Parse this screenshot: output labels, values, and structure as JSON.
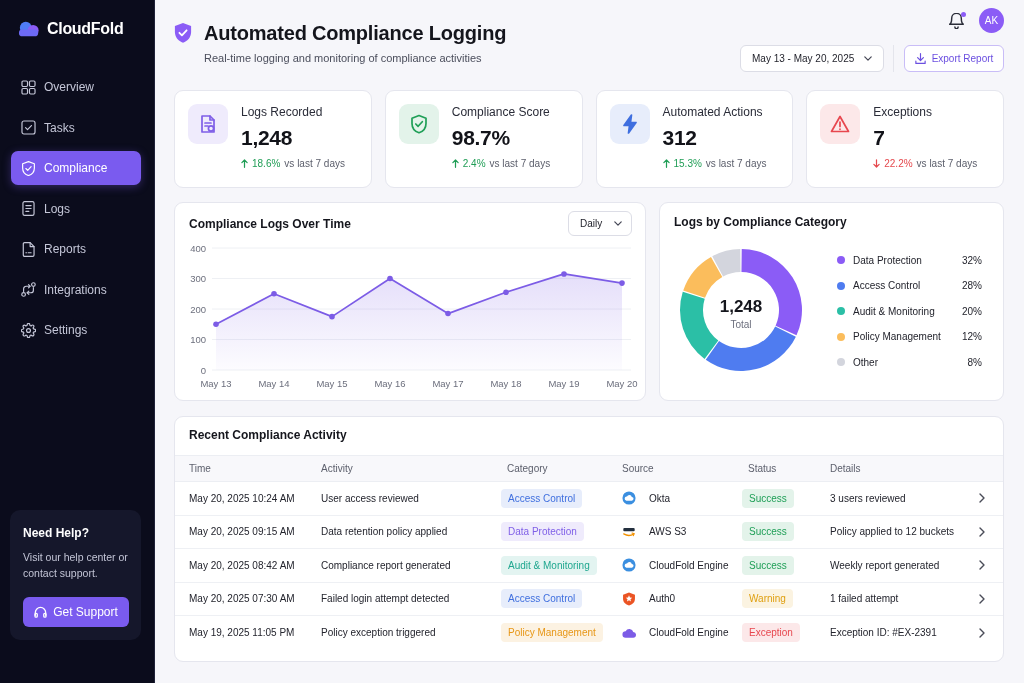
{
  "sidebar": {
    "brand": "CloudFold",
    "nav": [
      {
        "label": "Overview",
        "kind": "grid",
        "selected": false
      },
      {
        "label": "Tasks",
        "kind": "check",
        "selected": false
      },
      {
        "label": "Compliance",
        "kind": "shield",
        "selected": true
      },
      {
        "label": "Logs",
        "kind": "logs",
        "selected": false
      },
      {
        "label": "Reports",
        "kind": "report",
        "selected": false
      },
      {
        "label": "Integrations",
        "kind": "integrations",
        "selected": false
      },
      {
        "label": "Settings",
        "kind": "gear",
        "selected": false
      }
    ],
    "help": {
      "title": "Need Help?",
      "text": "Visit our help center or contact support.",
      "button": "Get Support"
    }
  },
  "header": {
    "title": "Automated Compliance Logging",
    "subtitle": "Real-time logging and monitoring of compliance activities",
    "notifications": {
      "unread": true
    },
    "avatar": "AK",
    "date_range": "May 13 - May 20, 2025",
    "export_button": "Export Report"
  },
  "stats": [
    {
      "kind": "document",
      "color": "#efebfc",
      "label": "Logs Recorded",
      "value": "1,248",
      "rising": true,
      "change": "18.6%",
      "period": "vs last 7 days"
    },
    {
      "kind": "shield",
      "color": "#e3f3ea",
      "label": "Compliance Score",
      "value": "98.7%",
      "rising": true,
      "change": "2.4%",
      "period": "vs last 7 days"
    },
    {
      "kind": "bolt",
      "color": "#e7edfb",
      "label": "Automated Actions",
      "value": "312",
      "rising": true,
      "change": "15.3%",
      "period": "vs last 7 days"
    },
    {
      "kind": "warning",
      "color": "#fce8e9",
      "label": "Exceptions",
      "value": "7",
      "rising": false,
      "change": "22.2%",
      "period": "vs last 7 days"
    }
  ],
  "logs_chart": {
    "period": "Daily",
    "chart_data": {
      "type": "area",
      "title": "Compliance Logs Over Time",
      "categories": [
        "May 13",
        "May 14",
        "May 15",
        "May 16",
        "May 17",
        "May 18",
        "May 19",
        "May 20"
      ],
      "series": [
        {
          "color": "#7c5ce6",
          "values": [
            150,
            250,
            175,
            300,
            185,
            255,
            315,
            285
          ]
        }
      ],
      "ylim": [
        0,
        400
      ],
      "yticks": [
        0,
        100,
        200,
        300,
        400
      ],
      "grid": true
    }
  },
  "category_chart": {
    "chart_data": {
      "type": "donut",
      "title": "Logs by Compliance Category",
      "categories": [
        "Data Protection",
        "Access Control",
        "Audit & Monitoring",
        "Policy Management",
        "Other"
      ],
      "values": [
        32,
        28,
        20,
        12,
        8
      ],
      "colors": [
        "#8b5cf6",
        "#4f7cf0",
        "#2bbfa6",
        "#fbbd5c",
        "#d3d5dd"
      ],
      "value_labels": [
        "32%",
        "28%",
        "20%",
        "12%",
        "8%"
      ]
    },
    "center_value": "1,248",
    "center_label": "Total"
  },
  "activity": {
    "title": "Recent Compliance Activity",
    "columns": [
      "Time",
      "Activity",
      "Category",
      "Source",
      "Status",
      "Details"
    ],
    "rows": [
      {
        "time": "May 20, 2025 10:24 AM",
        "activity": "User access reviewed",
        "category": {
          "label": "Access Control",
          "color": "#e7edfb"
        },
        "source": {
          "name": "Okta",
          "kind": "disc"
        },
        "status": {
          "label": "Success",
          "color": "#e3f3ea"
        },
        "details": "3 users reviewed"
      },
      {
        "time": "May 20, 2025 09:15 AM",
        "activity": "Data retention policy applied",
        "category": {
          "label": "Data Protection",
          "color": "#efebfc"
        },
        "source": {
          "name": "AWS S3",
          "kind": "swoosh"
        },
        "status": {
          "label": "Success",
          "color": "#e3f3ea"
        },
        "details": "Policy applied to 12 buckets"
      },
      {
        "time": "May 20, 2025 08:42 AM",
        "activity": "Compliance report generated",
        "category": {
          "label": "Audit & Monitoring",
          "color": "#e3f4f1"
        },
        "source": {
          "name": "CloudFold Engine",
          "kind": "disc"
        },
        "status": {
          "label": "Success",
          "color": "#e3f3ea"
        },
        "details": "Weekly report generated"
      },
      {
        "time": "May 20, 2025 07:30 AM",
        "activity": "Failed login attempt detected",
        "category": {
          "label": "Access Control",
          "color": "#e7edfb"
        },
        "source": {
          "name": "Auth0",
          "kind": "shield"
        },
        "status": {
          "label": "Warning",
          "color": "#fbf3e1"
        },
        "details": "1 failed attempt"
      },
      {
        "time": "May 19, 2025 11:05 PM",
        "activity": "Policy exception triggered",
        "category": {
          "label": "Policy Management",
          "color": "#fcf2e2"
        },
        "source": {
          "name": "CloudFold Engine",
          "kind": "cloud"
        },
        "status": {
          "label": "Exception",
          "color": "#fce8e9"
        },
        "details": "Exception ID: #EX-2391"
      }
    ]
  }
}
